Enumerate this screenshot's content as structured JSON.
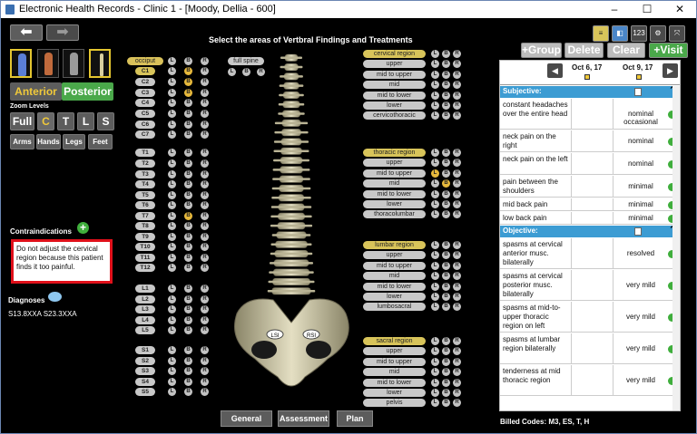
{
  "window": {
    "title": "Electronic Health Records - Clinic 1 - [Moody, Dellia - 600]",
    "controls": [
      "–",
      "☐",
      "✕"
    ]
  },
  "left": {
    "view_buttons": [
      "Anterior",
      "Posterior"
    ],
    "zoom_label": "Zoom Levels",
    "zoom_buttons": [
      "Full",
      "C",
      "T",
      "L",
      "S"
    ],
    "part_buttons": [
      "Arms",
      "Hands",
      "Legs",
      "Feet"
    ],
    "contra_label": "Contraindications",
    "contra_text": "Do not adjust the cervical region because this patient finds it too painful.",
    "diag_label": "Diagnoses",
    "diag_codes": "S13.8XXA S23.3XXA",
    "colors": {
      "accent_yellow": "#d9c15a",
      "green": "#3fae3c",
      "red": "#e0101a"
    }
  },
  "center": {
    "title": "Select the areas of Vertbral Findings and Treatments",
    "occiput": "occiput",
    "full_spine": "full spine",
    "lbr": [
      "L",
      "B",
      "R"
    ],
    "vertebrae": [
      "C1",
      "C2",
      "C3",
      "C4",
      "C5",
      "C6",
      "C7",
      "T1",
      "T2",
      "T3",
      "T4",
      "T5",
      "T6",
      "T7",
      "T8",
      "T9",
      "T10",
      "T11",
      "T12",
      "L1",
      "L2",
      "L3",
      "L4",
      "L5",
      "S1",
      "S2",
      "S3",
      "S4",
      "S5"
    ],
    "regions": [
      [
        "cervical region",
        "upper",
        "mid to upper",
        "mid",
        "mid to lower",
        "lower",
        "cervicothoracic"
      ],
      [
        "thoracic region",
        "upper",
        "mid to upper",
        "mid",
        "mid to lower",
        "lower",
        "thoracolumbar"
      ],
      [
        "lumbar region",
        "upper",
        "mid to upper",
        "mid",
        "mid to lower",
        "lower",
        "lumbosacral"
      ],
      [
        "sacral region",
        "upper",
        "mid to upper",
        "mid",
        "mid to lower",
        "lower",
        "pelvis"
      ]
    ],
    "pelvis_labels": [
      "LSI",
      "RSI"
    ],
    "bottom_buttons": [
      "General",
      "Assessment",
      "Plan"
    ]
  },
  "right": {
    "top_buttons": [
      "+Group",
      "Delete",
      "Clear",
      "+Visit"
    ],
    "icon_buttons": [
      "≡",
      "◧",
      "123",
      "⚙",
      "⤧"
    ],
    "dates": [
      "Oct 6, 17",
      "Oct 9, 17"
    ],
    "subjective": {
      "name": "Subjective:",
      "rows": [
        [
          "constant headaches over the entire head",
          "nominal occasional"
        ],
        [
          "neck pain on the right",
          "nominal"
        ],
        [
          "neck pain on the left",
          "nominal"
        ],
        [
          "pain between the shoulders",
          "minimal"
        ],
        [
          "mid back pain",
          "minimal"
        ],
        [
          "low back pain",
          "minimal"
        ]
      ]
    },
    "objective": {
      "name": "Objective:",
      "rows": [
        [
          "spasms at cervical anterior musc. bilaterally",
          "resolved"
        ],
        [
          "spasms at cervical posterior musc. bilaterally",
          "very mild"
        ],
        [
          "spasms at mid-to-upper thoracic region on left",
          "very mild"
        ],
        [
          "spasms at lumbar region bilaterally",
          "very mild"
        ],
        [
          "tenderness at mid thoracic region",
          "very mild"
        ]
      ]
    },
    "billed_label": "Billed Codes:",
    "billed_codes": "M3, ES, T, H"
  }
}
